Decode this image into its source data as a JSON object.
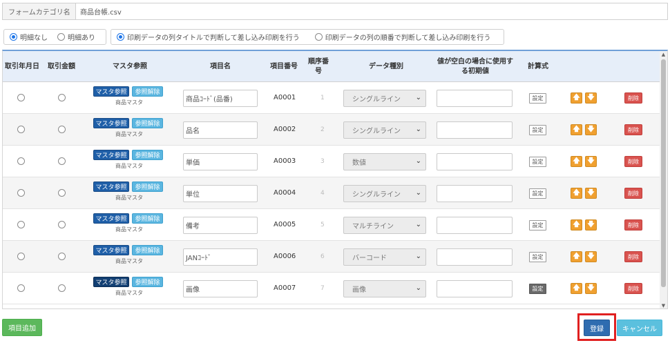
{
  "form": {
    "category_label": "フォームカテゴリ名",
    "category_value": "商品台帳.csv"
  },
  "detail_options": [
    {
      "label": "明細なし",
      "selected": true
    },
    {
      "label": "明細あり",
      "selected": false
    }
  ],
  "print_options": [
    {
      "label": "印刷データの列タイトルで判断して差し込み印刷を行う",
      "selected": true
    },
    {
      "label": "印刷データの列の順番で判断して差し込み印刷を行う",
      "selected": false
    }
  ],
  "table": {
    "headers": {
      "trade_date": "取引年月日",
      "trade_amount": "取引金額",
      "master_ref": "マスタ参照",
      "item_name": "項目名",
      "item_number": "項目番号",
      "order": "順序番号",
      "data_type": "データ種別",
      "default_value": "値が空白の場合に使用する初期値",
      "formula": "計算式"
    },
    "labels": {
      "master_button": "マスタ参照",
      "clear_button": "参照解除",
      "master_name": "商品マスタ",
      "calc_button": "設定",
      "up_arrow": "🡅",
      "down_arrow": "🡇",
      "delete_button": "削除"
    },
    "rows": [
      {
        "item_name": "商品ｺｰﾄﾞ(品番)",
        "item_number": "A0001",
        "order": "1",
        "data_type": "シングルライン",
        "default_value": ""
      },
      {
        "item_name": "品名",
        "item_number": "A0002",
        "order": "2",
        "data_type": "シングルライン",
        "default_value": ""
      },
      {
        "item_name": "単価",
        "item_number": "A0003",
        "order": "3",
        "data_type": "数値",
        "default_value": ""
      },
      {
        "item_name": "単位",
        "item_number": "A0004",
        "order": "4",
        "data_type": "シングルライン",
        "default_value": ""
      },
      {
        "item_name": "備考",
        "item_number": "A0005",
        "order": "5",
        "data_type": "マルチライン",
        "default_value": ""
      },
      {
        "item_name": "JANｺｰﾄﾞ",
        "item_number": "A0006",
        "order": "6",
        "data_type": "バーコード",
        "default_value": ""
      },
      {
        "item_name": "画像",
        "item_number": "A0007",
        "order": "7",
        "data_type": "画像",
        "default_value": ""
      }
    ]
  },
  "footer": {
    "add_label": "項目追加",
    "register_label": "登録",
    "cancel_label": "キャンセル"
  },
  "colors": {
    "header_accent": "#6f9fd8",
    "register": "#2f6cb0",
    "highlight": "#e02020",
    "delete": "#d9534f",
    "arrow": "#f0a030",
    "add": "#5cb85c"
  }
}
